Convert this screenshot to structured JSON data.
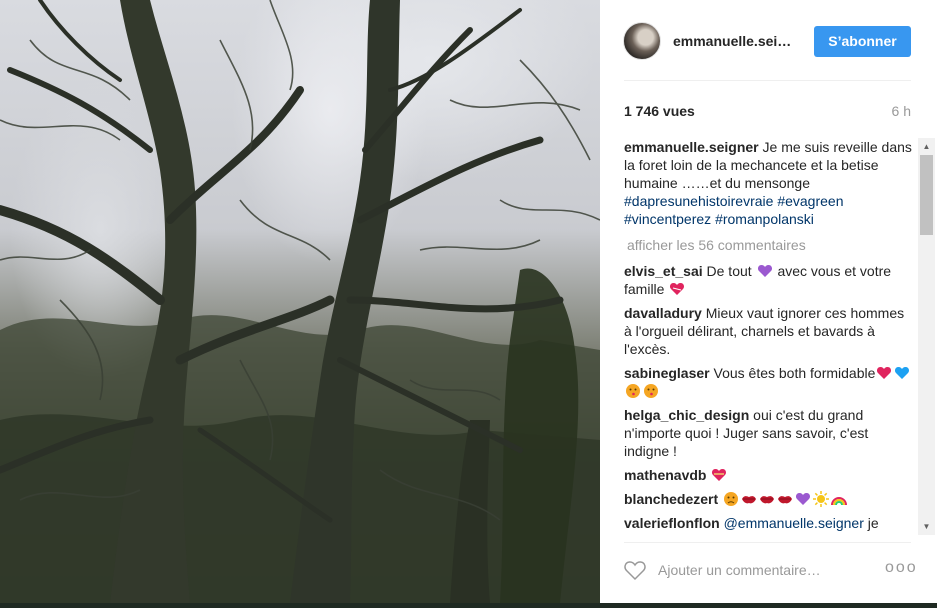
{
  "post": {
    "username": "emmanuelle.sei…",
    "follow_label": "S’abonner",
    "views": "1 746 vues",
    "time_ago": "6 h"
  },
  "caption": {
    "author": "emmanuelle.seigner",
    "text": "Je me suis reveille dans la foret loin de la mechancete et la betise humaine ……et du mensonge",
    "hashtags": [
      "#dapresunehistoirevraie",
      "#evagreen",
      "#vincentperez",
      "#romanpolanski"
    ]
  },
  "load_more": "afficher les 56 commentaires",
  "comments": [
    {
      "author": "elvis_et_sai",
      "text_a": "De tout",
      "text_b": "avec vous et votre famille"
    },
    {
      "author": "davalladury",
      "text": "Mieux vaut ignorer ces hommes à l'orgueil délirant, charnels et bavards à l'excès."
    },
    {
      "author": "sabineglaser",
      "text": "Vous êtes both formidable"
    },
    {
      "author": "helga_chic_design",
      "text": "oui c'est du grand n'importe quoi ! Juger sans savoir, c'est indigne !"
    },
    {
      "author": "mathenavdb",
      "text": ""
    },
    {
      "author": "blanchedezert",
      "text": ""
    },
    {
      "author": "valerieflonflon",
      "mention": "@emmanuelle.seigner",
      "text": "je"
    }
  ],
  "footer": {
    "placeholder": "Ajouter un commentaire…",
    "more": "ooo"
  },
  "icons": [
    "heart-outline-icon",
    "more-options-icon",
    "purple-heart-icon",
    "red-heart-icon",
    "blue-heart-icon",
    "kiss-face-icon",
    "lips-icon",
    "sun-icon",
    "rainbow-icon",
    "sad-face-icon"
  ],
  "colors": {
    "follow_blue": "#3897f0",
    "link": "#003569",
    "muted": "#999999"
  }
}
